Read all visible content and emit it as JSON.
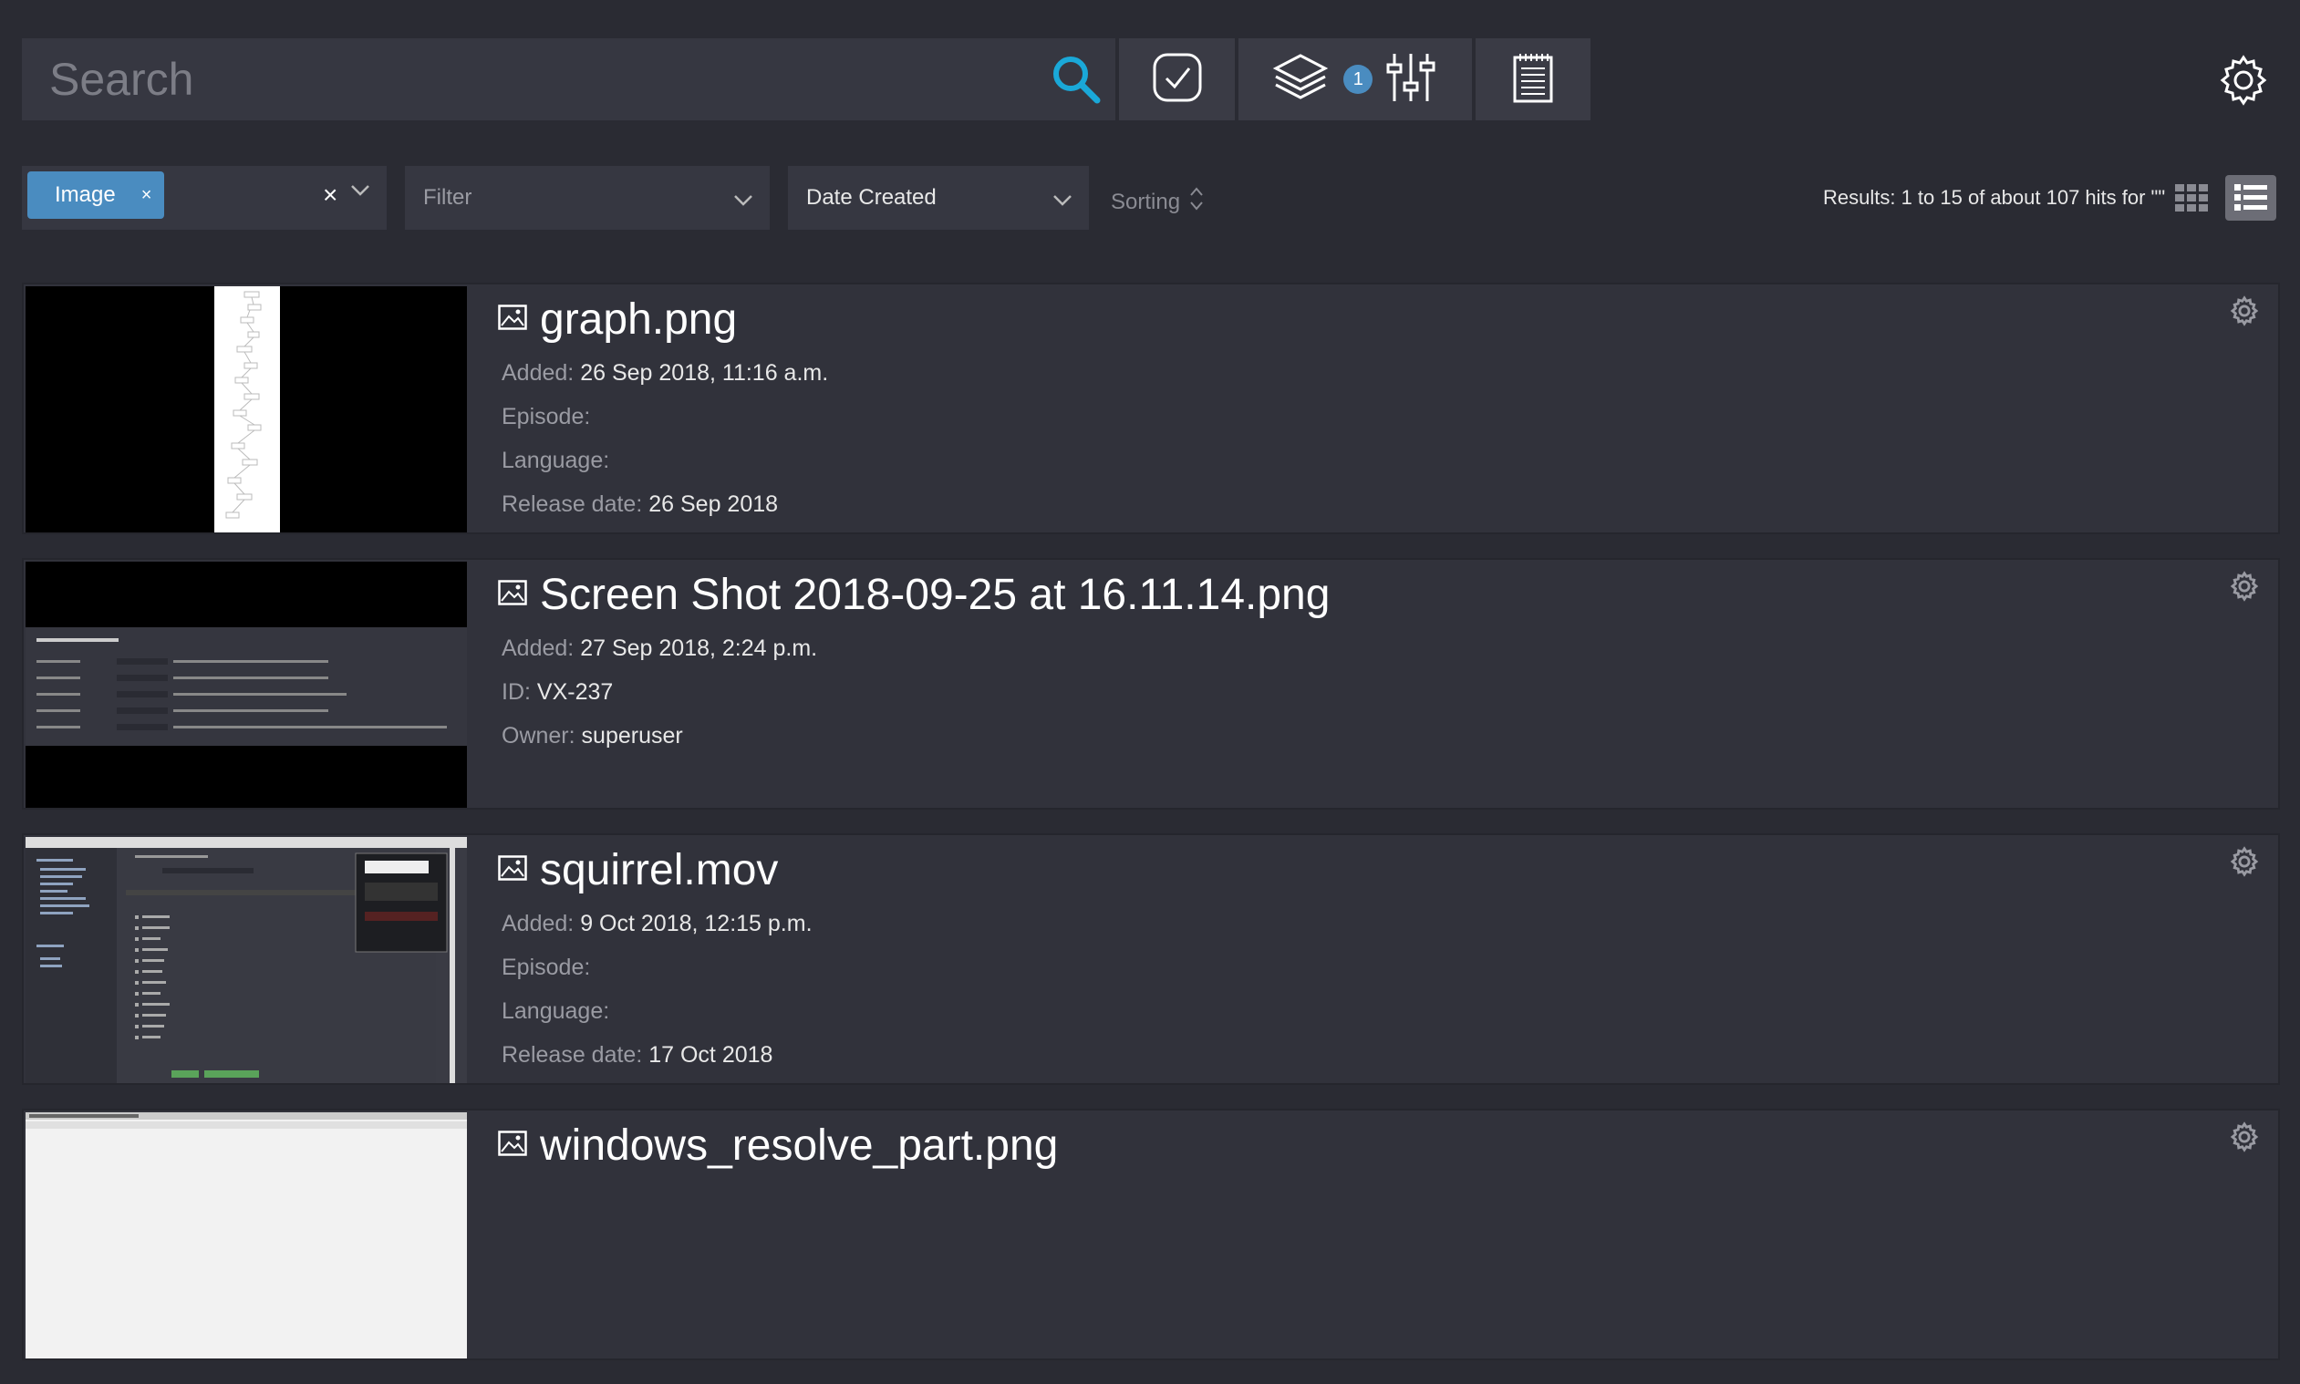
{
  "search": {
    "placeholder": "Search"
  },
  "toolbar": {
    "layers_count": "1"
  },
  "filters": {
    "selected_chip": "Image",
    "chip_remove": "×",
    "clear": "×",
    "filter_placeholder": "Filter",
    "sort_field": "Date Created",
    "sorting_label": "Sorting",
    "results_text": "Results: 1 to 15 of about 107 hits for \"\""
  },
  "items": [
    {
      "title": "graph.png",
      "meta": [
        {
          "label": "Added:",
          "value": "26 Sep 2018, 11:16 a.m."
        },
        {
          "label": "Episode:",
          "value": ""
        },
        {
          "label": "Language:",
          "value": ""
        },
        {
          "label": "Release date:",
          "value": "26 Sep 2018"
        }
      ]
    },
    {
      "title": "Screen Shot 2018-09-25 at 16.11.14.png",
      "meta": [
        {
          "label": "Added:",
          "value": "27 Sep 2018, 2:24 p.m."
        },
        {
          "label": "ID:",
          "value": "VX-237"
        },
        {
          "label": "Owner:",
          "value": "superuser"
        }
      ]
    },
    {
      "title": "squirrel.mov",
      "meta": [
        {
          "label": "Added:",
          "value": "9 Oct 2018, 12:15 p.m."
        },
        {
          "label": "Episode:",
          "value": ""
        },
        {
          "label": "Language:",
          "value": ""
        },
        {
          "label": "Release date:",
          "value": "17 Oct 2018"
        }
      ]
    },
    {
      "title": "windows_resolve_part.png",
      "meta": []
    }
  ],
  "icons": {
    "search": "search-icon",
    "check": "checkbox-icon",
    "layers": "layers-icon",
    "sliders": "sliders-icon",
    "notepad": "notepad-icon",
    "settings": "gear-icon",
    "grid": "grid-view-icon",
    "list": "list-view-icon",
    "image": "image-icon"
  },
  "colors": {
    "accent": "#4a8cc0",
    "search_icon": "#1aa8d8",
    "background": "#2a2b33",
    "panel": "#363741"
  }
}
